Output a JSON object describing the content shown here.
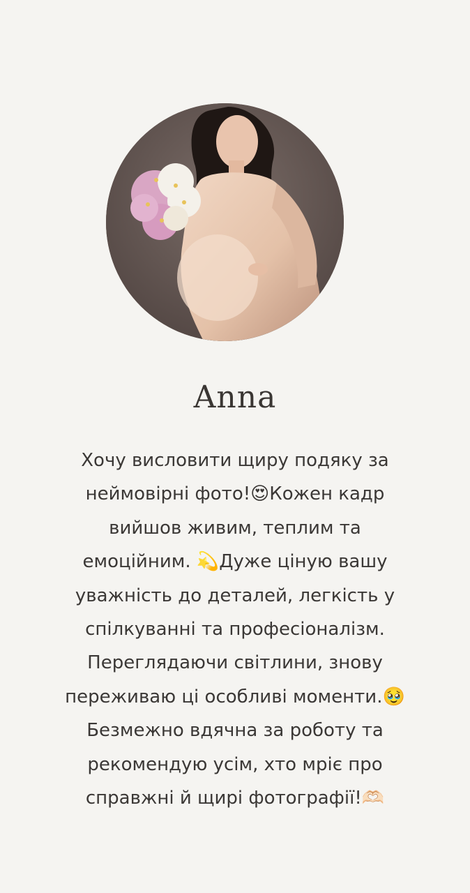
{
  "testimonial": {
    "photo_alt": "Anna",
    "name": "Anna",
    "review_lines": [
      "Хочу висловити щиру подяку за",
      "неймовірні фото!😍Кожен кадр",
      "вийшов живим, теплим та",
      "емоційним. 💫Дуже ціную вашу",
      "уважність до деталей, легкість у",
      "спілкуванні та професіоналізм.",
      "Переглядаючи світлини, знову",
      "переживаю ці особливі моменти.🥹",
      "Безмежно вдячна за роботу та",
      "рекомендую усім, хто мріє про",
      "справжні й щирі фотографії!🫶🏻"
    ]
  },
  "colors": {
    "background": "#f5f4f1",
    "text": "#3b3836",
    "photo_backdrop": "#6b5d59",
    "dress": "#e7c8b2",
    "hair": "#1f1714",
    "flowers_pink": "#d9a6c4",
    "flowers_white": "#f4f1ea"
  }
}
